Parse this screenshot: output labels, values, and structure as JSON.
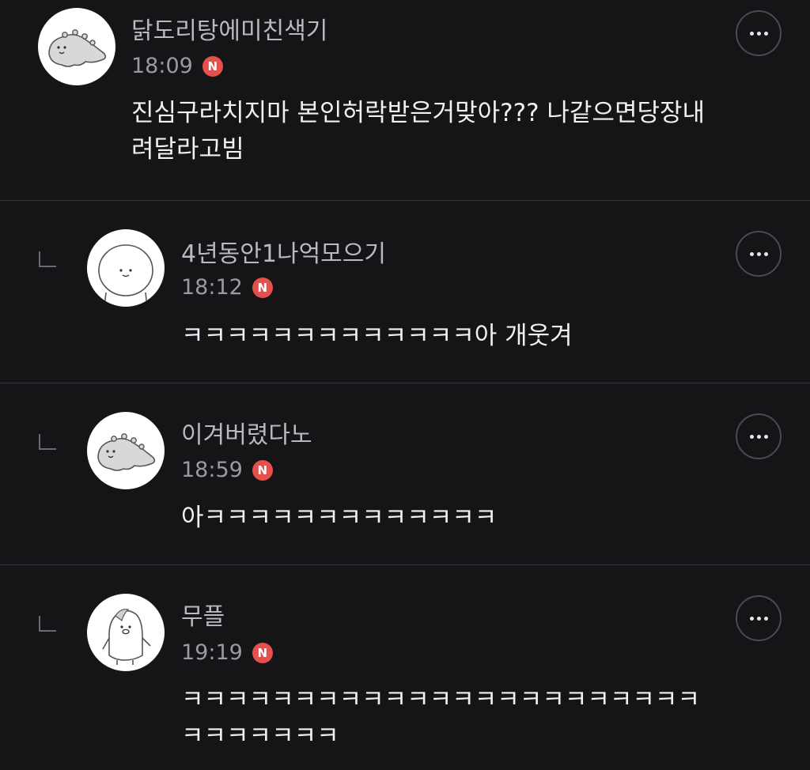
{
  "comments": [
    {
      "author": "닭도리탕에미친색기",
      "time": "18:09",
      "badge": "N",
      "avatar_icon": "dinosaur-avatar-icon",
      "is_reply": false,
      "body_lines": [
        "진심구라치지마 본인허락받은거맞아??? 나같으면당장내",
        "려달라고빔"
      ]
    },
    {
      "author": "4년동안1나억모으기",
      "time": "18:12",
      "badge": "N",
      "avatar_icon": "round-face-avatar-icon",
      "is_reply": true,
      "body_lines": [
        "ㅋㅋㅋㅋㅋㅋㅋㅋㅋㅋㅋㅋㅋ아 개웃겨"
      ]
    },
    {
      "author": "이겨버렸다노",
      "time": "18:59",
      "badge": "N",
      "avatar_icon": "dinosaur-avatar-icon",
      "is_reply": true,
      "body_lines": [
        "아ㅋㅋㅋㅋㅋㅋㅋㅋㅋㅋㅋㅋㅋ"
      ]
    },
    {
      "author": "무플",
      "time": "19:19",
      "badge": "N",
      "avatar_icon": "penguin-avatar-icon",
      "is_reply": true,
      "body_lines": [
        "ㅋㅋㅋㅋㅋㅋㅋㅋㅋㅋㅋㅋㅋㅋㅋㅋㅋㅋㅋㅋㅋㅋㅋ",
        "ㅋㅋㅋㅋㅋㅋㅋ"
      ]
    }
  ],
  "colors": {
    "background": "#151518",
    "badge": "#e5504a",
    "divider": "#34343a"
  }
}
